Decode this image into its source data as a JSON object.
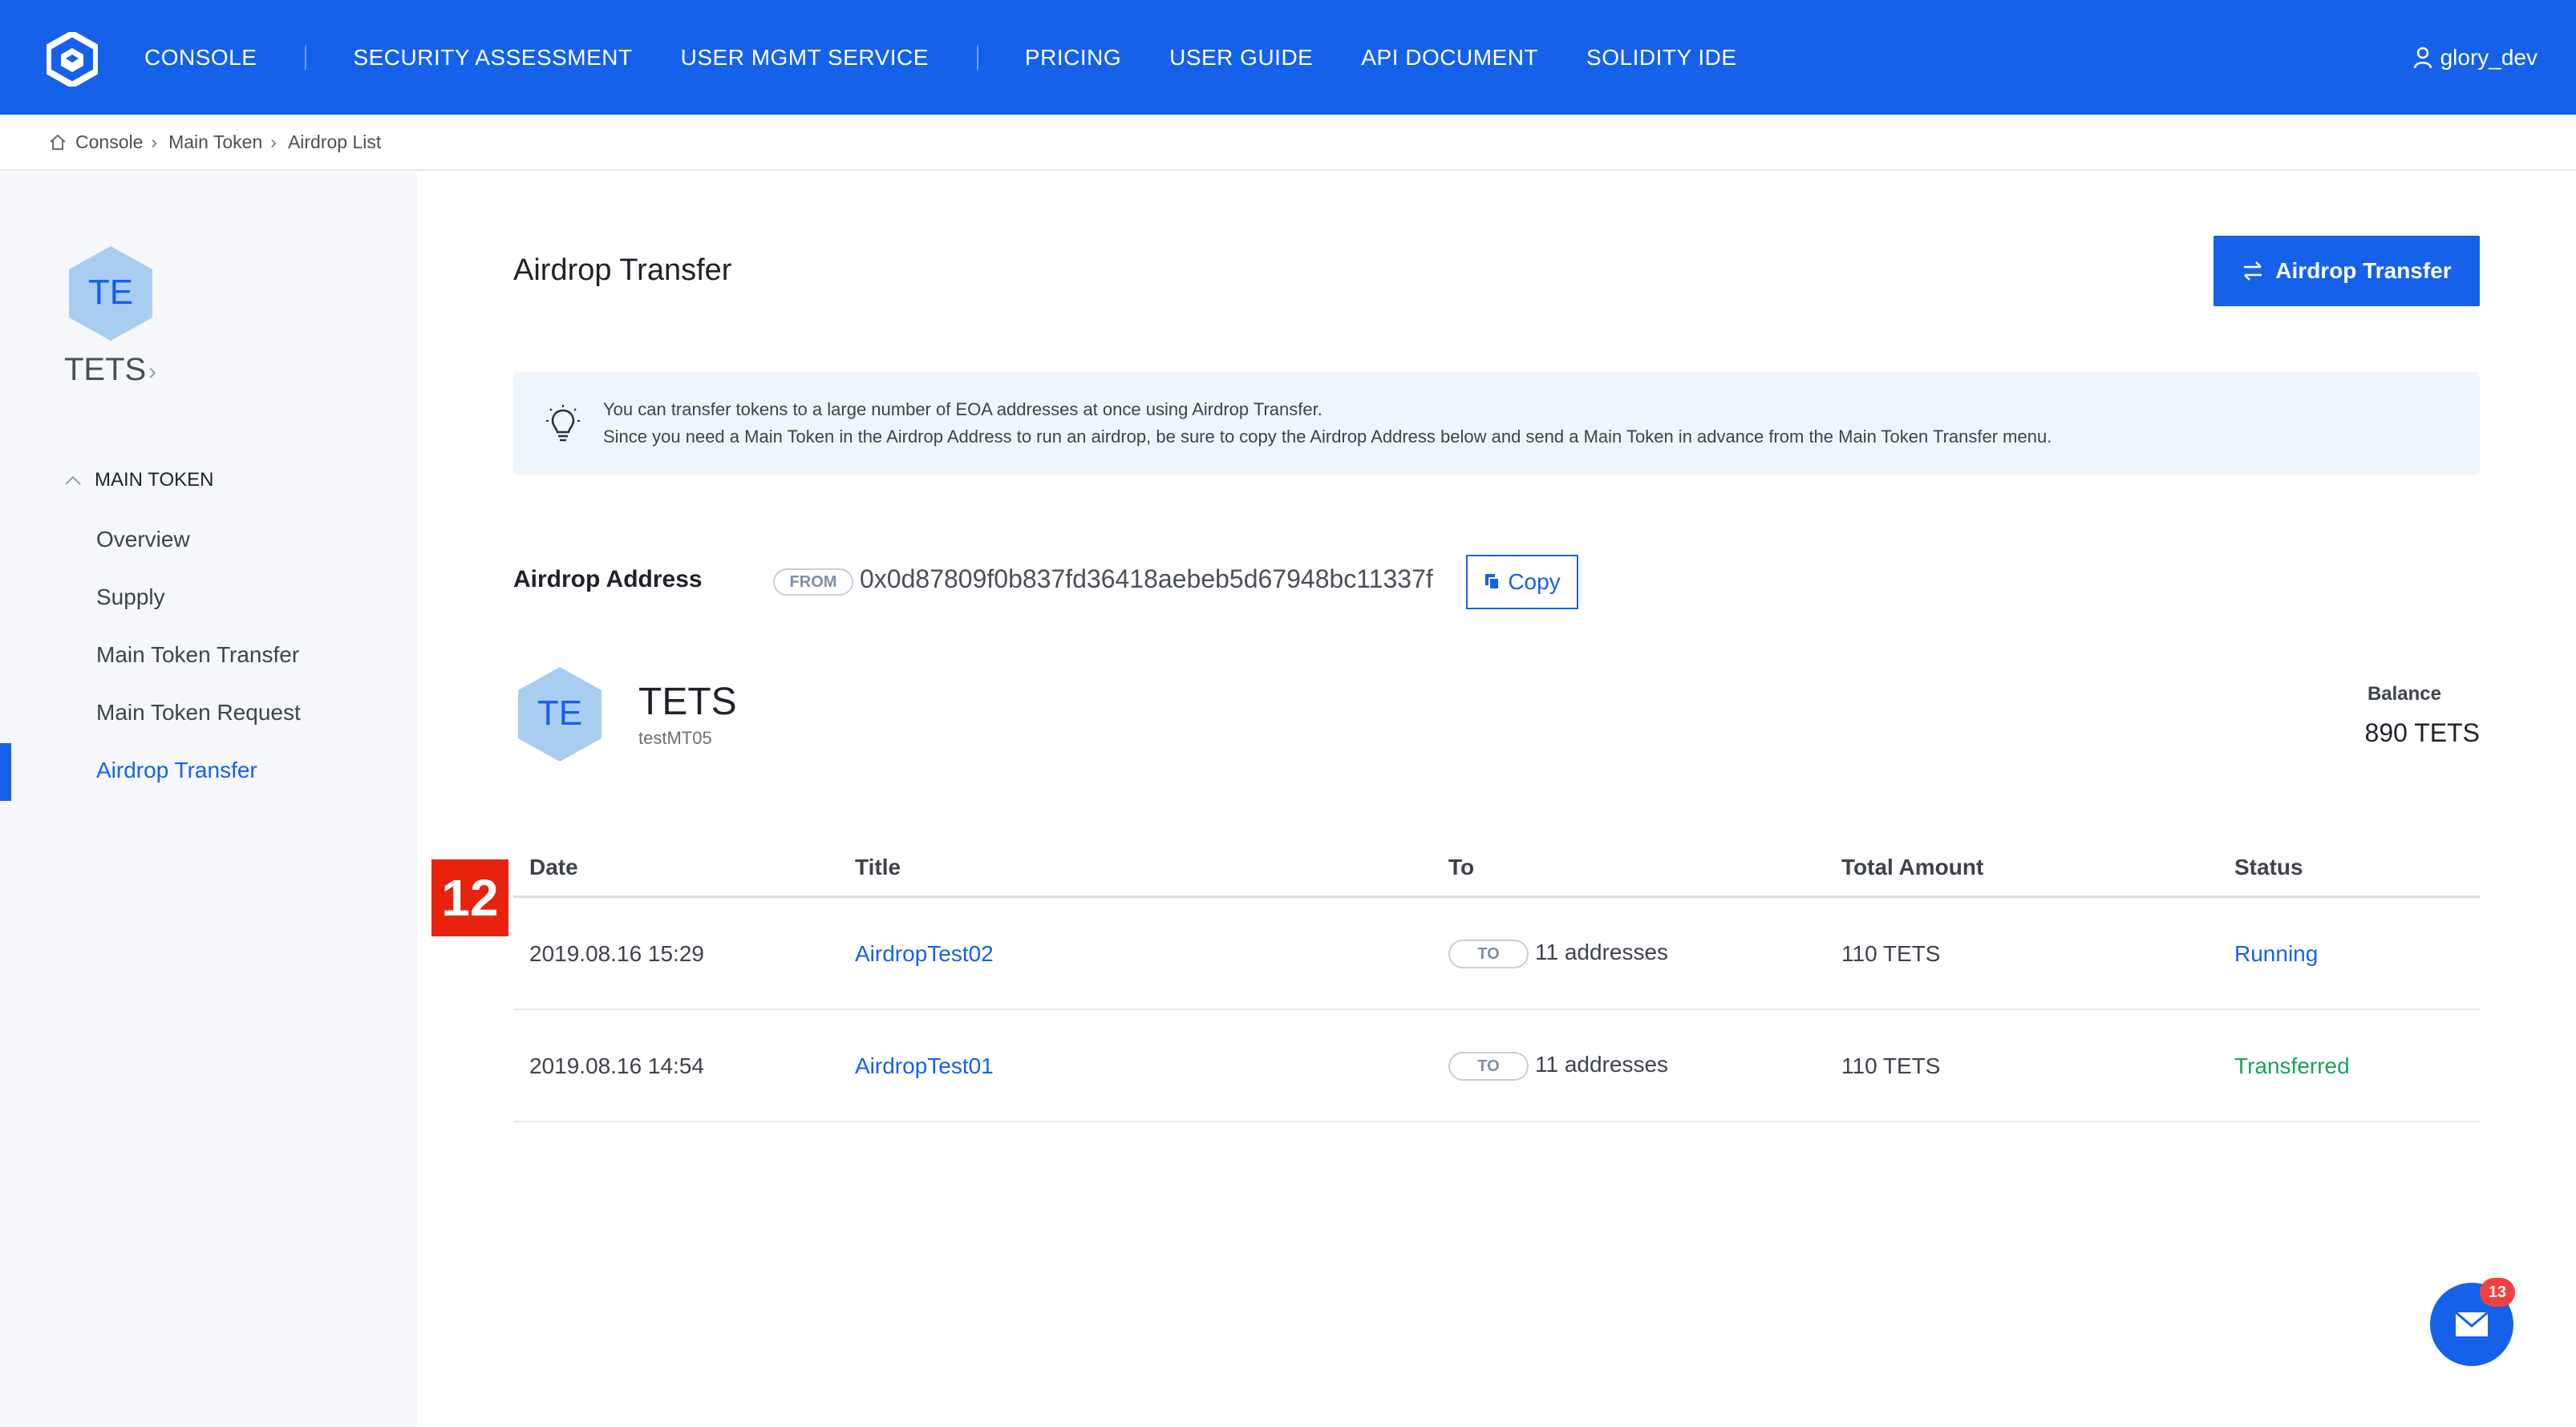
{
  "topbar": {
    "nav": [
      "CONSOLE",
      "SECURITY ASSESSMENT",
      "USER MGMT SERVICE",
      "PRICING",
      "USER GUIDE",
      "API DOCUMENT",
      "SOLIDITY IDE"
    ],
    "user": "glory_dev",
    "color": "#1561ea"
  },
  "breadcrumb": [
    "Console",
    "Main Token",
    "Airdrop List"
  ],
  "sidebar": {
    "token_initials": "TE",
    "token_name": "TETS",
    "section": "MAIN TOKEN",
    "items": [
      "Overview",
      "Supply",
      "Main Token Transfer",
      "Main Token Request",
      "Airdrop Transfer"
    ],
    "active_index": 4
  },
  "main": {
    "title": "Airdrop Transfer",
    "action_button": "Airdrop Transfer",
    "info_lines": [
      "You can transfer tokens to a large number of EOA addresses at once using Airdrop Transfer.",
      "Since you need a Main Token in the Airdrop Address to run an airdrop, be sure to copy the Airdrop Address below and send a Main Token in advance from the Main Token Transfer menu."
    ],
    "airdrop_address_label": "Airdrop Address",
    "from_tag": "FROM",
    "airdrop_address": "0x0d87809f0b837fd36418aebeb5d67948bc11337f",
    "copy_button": "Copy",
    "token_initials": "TE",
    "token_name": "TETS",
    "token_sub": "testMT05",
    "balance_label": "Balance",
    "balance_value": "890 TETS",
    "marker": "12"
  },
  "table": {
    "headers": [
      "Date",
      "Title",
      "To",
      "Total Amount",
      "Status"
    ],
    "to_tag": "TO",
    "rows": [
      {
        "date": "2019.08.16 15:29",
        "title": "AirdropTest02",
        "to": "11 addresses",
        "amount": "110 TETS",
        "status": "Running"
      },
      {
        "date": "2019.08.16 14:54",
        "title": "AirdropTest01",
        "to": "11 addresses",
        "amount": "110 TETS",
        "status": "Transferred"
      }
    ]
  },
  "fab": {
    "badge": "13"
  }
}
